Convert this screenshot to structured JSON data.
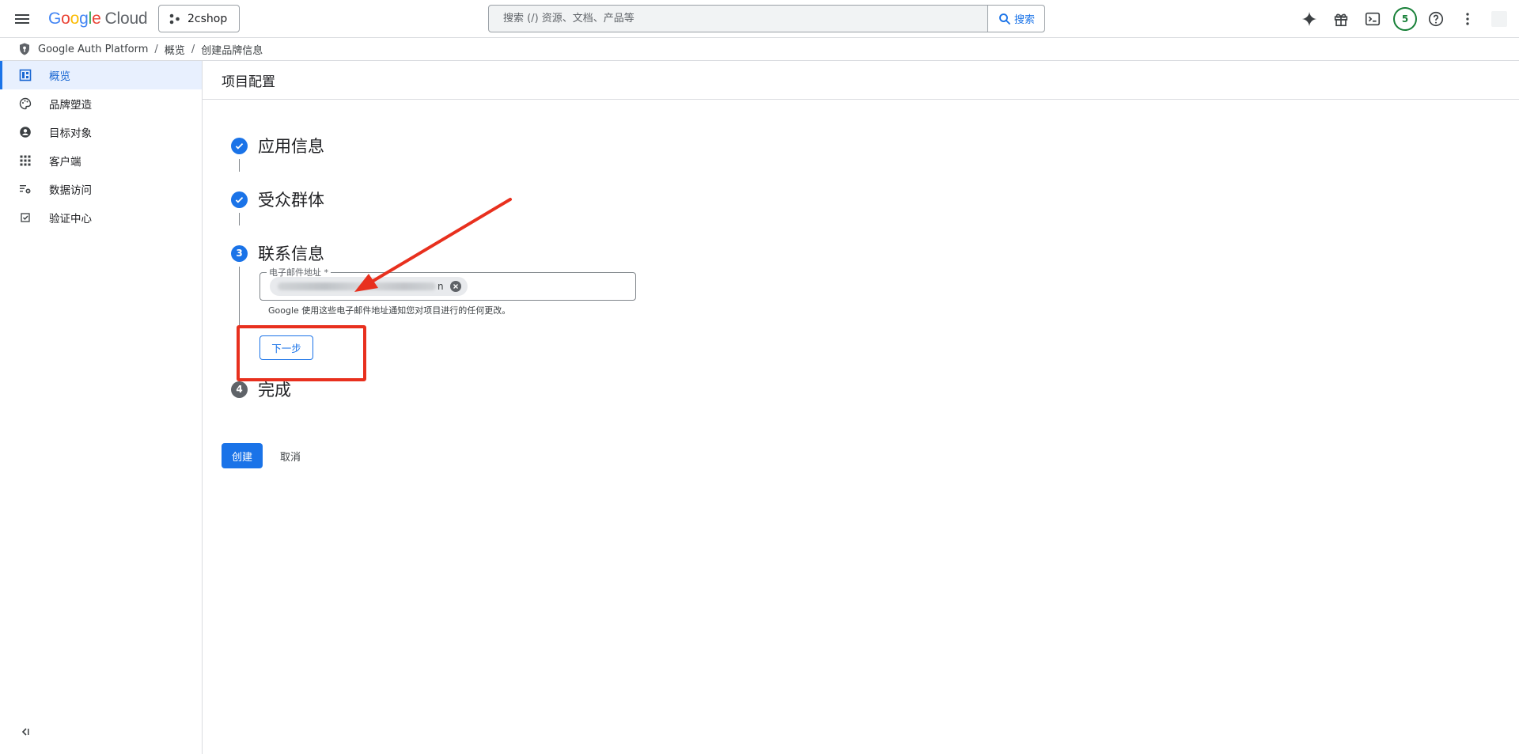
{
  "header": {
    "logo": {
      "google": "Google",
      "cloud": "Cloud"
    },
    "project": "2cshop",
    "search": {
      "placeholder": "搜索 (/) 资源、文档、产品等",
      "button_label": "搜索"
    },
    "notifications_count": "5"
  },
  "breadcrumb": {
    "items": [
      "Google Auth Platform",
      "概览",
      "创建品牌信息"
    ],
    "separator": "/"
  },
  "sidebar": {
    "items": [
      {
        "label": "概览",
        "icon": "dashboard-icon",
        "active": true
      },
      {
        "label": "品牌塑造",
        "icon": "palette-icon"
      },
      {
        "label": "目标对象",
        "icon": "account-circle-icon"
      },
      {
        "label": "客户端",
        "icon": "apps-grid-icon"
      },
      {
        "label": "数据访问",
        "icon": "data-settings-icon"
      },
      {
        "label": "验证中心",
        "icon": "verified-checkbox-icon"
      }
    ]
  },
  "main": {
    "title": "项目配置",
    "steps": [
      {
        "number": "1",
        "title": "应用信息",
        "state": "done"
      },
      {
        "number": "2",
        "title": "受众群体",
        "state": "done"
      },
      {
        "number": "3",
        "title": "联系信息",
        "state": "current"
      },
      {
        "number": "4",
        "title": "完成",
        "state": "pending"
      }
    ],
    "email_field": {
      "label": "电子邮件地址 *",
      "chip_tail": "n"
    },
    "helper_text": "Google 使用这些电子邮件地址通知您对项目进行的任何更改。",
    "next_button": "下一步",
    "create_button": "创建",
    "cancel_button": "取消"
  },
  "colors": {
    "primary": "#1a73e8",
    "annotation_red": "#e8301e",
    "badge_green": "#188038"
  }
}
